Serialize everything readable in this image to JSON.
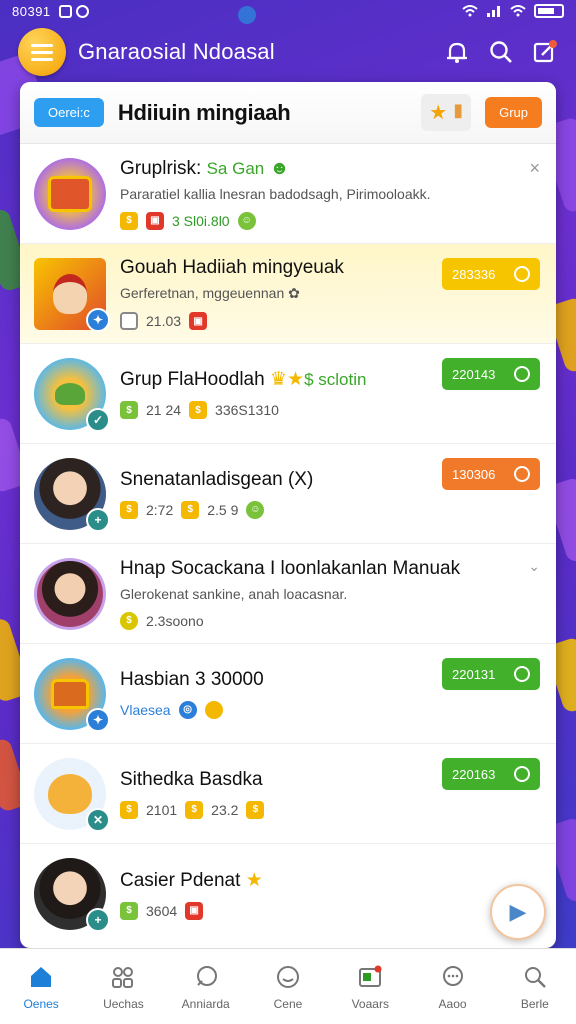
{
  "status": {
    "time": "80391"
  },
  "app": {
    "title": "Gnaraosial Ndoasal"
  },
  "header": {
    "left_button": "Oerei:c",
    "title": "Hdiiuin mingiaah",
    "right_button": "Grup"
  },
  "rows": [
    {
      "name": "Gruplrisk: ",
      "name_accent": "Sa Gan",
      "subtitle": "Pararatiel kallia lnesran  badodsagh, Pirimooloakk.",
      "meta_a": "3 Sl0i.8l0",
      "badge_color": "#8e44d6"
    },
    {
      "name": "Gouah Hadiiah mingyeuak",
      "subtitle": "Gerferetnan, mggeuennan",
      "meta_a": "21.03",
      "pill": "283336",
      "pill_color": "#f7c400"
    },
    {
      "name": "Grup FlaHoodlah",
      "name_accent": "$ sclotin",
      "meta_a": "21 24",
      "meta_b": "336S1310",
      "pill": "220143",
      "pill_color": "#42b02a"
    },
    {
      "name": "Snenatanladisgean (X)",
      "meta_a": "2:72",
      "meta_b": "2.5 9",
      "pill": "130306",
      "pill_color": "#f07a2a"
    },
    {
      "name": "Hnap Socackana I loonlakanlan Manuak",
      "subtitle": "Glerokenat sankine, anah loacasnar.",
      "meta_a": "2.3soono"
    },
    {
      "name": "Hasbian 3 30000",
      "meta_a": "Vlaesea",
      "pill": "220131",
      "pill_color": "#42b02a"
    },
    {
      "name": "Sithedka Basdka",
      "meta_a": "2101",
      "meta_b": "23.2",
      "pill": "220163",
      "pill_color": "#42b02a"
    },
    {
      "name": "Casier Pdenat",
      "meta_a": "3604"
    }
  ],
  "nav": [
    {
      "label": "Oenes",
      "icon": "home-icon"
    },
    {
      "label": "Uechas",
      "icon": "groups-icon"
    },
    {
      "label": "Anniarda",
      "icon": "chat-icon"
    },
    {
      "label": "Cene",
      "icon": "smile-icon"
    },
    {
      "label": "Voaars",
      "icon": "media-icon"
    },
    {
      "label": "Aaoo",
      "icon": "message-icon"
    },
    {
      "label": "Berle",
      "icon": "search-icon"
    }
  ],
  "colors": {
    "accent_blue": "#2e9ef0",
    "accent_orange": "#f57c1f",
    "accent_green": "#42b02a",
    "accent_yellow": "#f7c400"
  }
}
